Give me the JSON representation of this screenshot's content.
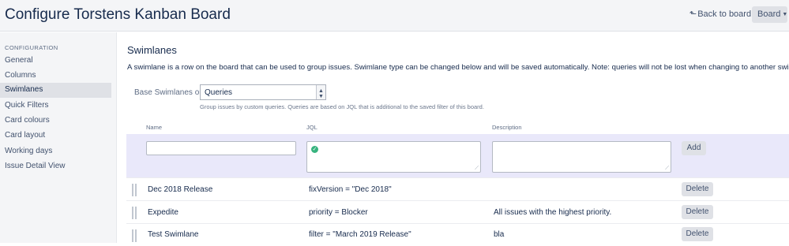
{
  "header": {
    "title": "Configure Torstens Kanban Board",
    "back_label": "Back to board",
    "board_label": "Board"
  },
  "sidebar": {
    "heading": "CONFIGURATION",
    "items": [
      {
        "label": "General"
      },
      {
        "label": "Columns"
      },
      {
        "label": "Swimlanes",
        "active": true
      },
      {
        "label": "Quick Filters"
      },
      {
        "label": "Card colours"
      },
      {
        "label": "Card layout"
      },
      {
        "label": "Working days"
      },
      {
        "label": "Issue Detail View"
      }
    ]
  },
  "main": {
    "title": "Swimlanes",
    "intro": "A swimlane is a row on the board that can be used to group issues. Swimlane type can be changed below and will be saved automatically. Note: queries will not be lost when changing to another swimlane type.",
    "base_label": "Base Swimlanes on",
    "base_value": "Queries",
    "help": "Group issues by custom queries. Queries are based on JQL that is additional to the saved filter of this board.",
    "columns": {
      "name": "Name",
      "jql": "JQL",
      "description": "Description"
    },
    "add_row": {
      "name": "",
      "jql": "",
      "description": "",
      "add_label": "Add"
    },
    "delete_label": "Delete",
    "rows": [
      {
        "name": "Dec 2018 Release",
        "jql": "fixVersion = \"Dec 2018\"",
        "description": ""
      },
      {
        "name": "Expedite",
        "jql": "priority = Blocker",
        "description": "All issues with the highest priority."
      },
      {
        "name": "Test Swimlane",
        "jql": "filter = \"March 2019 Release\"",
        "description": "bla"
      }
    ]
  },
  "colors": {
    "accent": "#36b37e",
    "add_row_bg": "#e9e8fa",
    "header_bg": "#f4f5f7"
  }
}
